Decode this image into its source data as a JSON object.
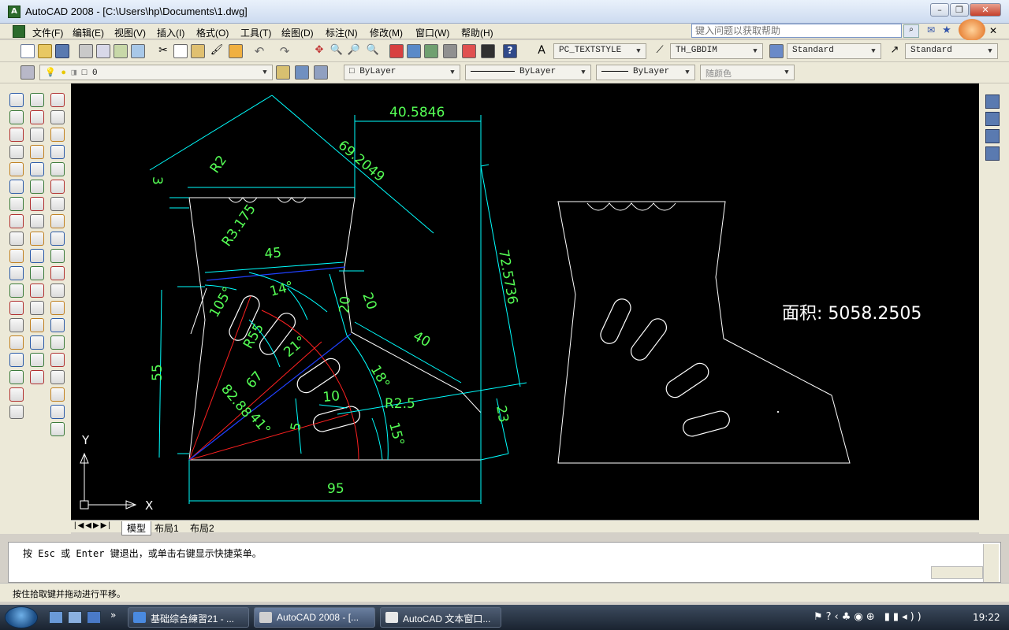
{
  "window": {
    "title": "AutoCAD 2008 - [C:\\Users\\hp\\Documents\\1.dwg]",
    "app_icon": "autocad-icon",
    "controls": [
      "minimize",
      "restore",
      "close"
    ]
  },
  "menubar": {
    "items": [
      "文件(F)",
      "编辑(E)",
      "视图(V)",
      "插入(I)",
      "格式(O)",
      "工具(T)",
      "绘图(D)",
      "标注(N)",
      "修改(M)",
      "窗口(W)",
      "帮助(H)"
    ],
    "help_placeholder": "键入问题以获取帮助"
  },
  "toolbar_styles": {
    "text_style": "PC_TEXTSTYLE",
    "dim_style": "TH_GBDIM",
    "table_style": "Standard",
    "multileader_style": "Standard"
  },
  "toolbar_layers": {
    "layer": "0",
    "color": "ByLayer",
    "linetype": "ByLayer",
    "lineweight": "ByLayer",
    "plotstyle": "随颜色"
  },
  "drawing": {
    "dimensions": {
      "d1": "40.5846",
      "d2": "69.2049",
      "d3": "72.5736",
      "d4": "3",
      "d5": "R2",
      "d6": "R3.175",
      "d7": "45",
      "d8": "105°",
      "d9": "14°",
      "d10": "20",
      "d11": "20",
      "d12": "40",
      "d13": "R55",
      "d14": "21°",
      "d15": "67",
      "d16": "18°",
      "d17": "55",
      "d18": "82.88",
      "d19": "41°",
      "d20": "10",
      "d21": "R2.5",
      "d22": "5",
      "d23": "15°",
      "d24": "23",
      "d25": "95"
    },
    "area_label": "面积: 5058.2505",
    "ucs_x": "X",
    "ucs_y": "Y"
  },
  "layout_tabs": [
    "模型",
    "布局1",
    "布局2"
  ],
  "command_line": "按 Esc 或 Enter 键退出，或单击右键显示快捷菜单。",
  "status_text": "按住拾取键并拖动进行平移。",
  "taskbar": {
    "items": [
      "基础综合練習21 - ...",
      "AutoCAD 2008 - [...",
      "AutoCAD 文本窗口..."
    ],
    "clock": "19:22"
  },
  "colors": {
    "dim": "#55ff55",
    "dim_line": "#00ffff",
    "object": "#ffffff",
    "red": "#ff2020",
    "blue": "#2040ff"
  }
}
